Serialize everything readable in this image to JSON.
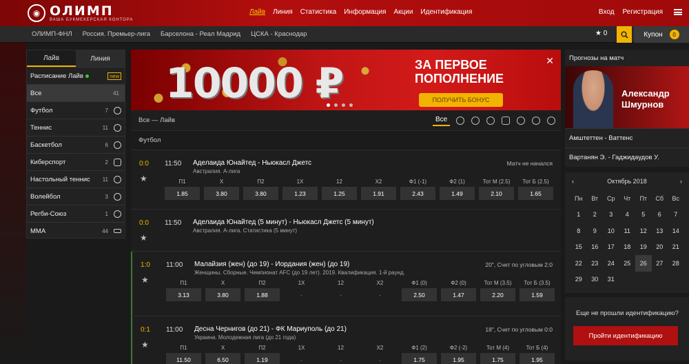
{
  "brand": {
    "name": "ОЛИМП",
    "tagline": "ВАША БУКМЕКЕРСКАЯ КОНТОРА"
  },
  "nav": [
    "Лайв",
    "Линия",
    "Статистика",
    "Информация",
    "Акции",
    "Идентификация"
  ],
  "auth": {
    "login": "Вход",
    "register": "Регистрация"
  },
  "quicklinks": [
    "ОЛИМП-ФНЛ",
    "Россия. Премьер-лига",
    "Барселона - Реал Мадрид",
    "ЦСКА - Краснодар"
  ],
  "favorites": "★ 0",
  "coupon": {
    "label": "Купон",
    "count": "0"
  },
  "left": {
    "tabs": [
      "Лайв",
      "Линия"
    ],
    "schedule": "Расписание Лайв",
    "new": "new",
    "items": [
      {
        "label": "Все",
        "count": "41"
      },
      {
        "label": "Футбол",
        "count": "7"
      },
      {
        "label": "Теннис",
        "count": "11"
      },
      {
        "label": "Баскетбол",
        "count": "6"
      },
      {
        "label": "Киберспорт",
        "count": "2"
      },
      {
        "label": "Настольный теннис",
        "count": "11"
      },
      {
        "label": "Волейбол",
        "count": "3"
      },
      {
        "label": "Регби-Союз",
        "count": "1"
      },
      {
        "label": "MMA",
        "count": "44"
      }
    ]
  },
  "banner": {
    "amount": "10000 ₽",
    "headline": "ЗА ПЕРВОЕ ПОПОЛНЕНИЕ",
    "button": "ПОЛУЧИТЬ БОНУС",
    "close": "✕"
  },
  "center": {
    "crumb": "Все — Лайв",
    "filter_all": "Все",
    "sport": "Футбол"
  },
  "matches": [
    {
      "score": "0:0",
      "time": "11:50",
      "title": "Аделаида Юнайтед - Ньюкасл Джетс",
      "league": "Австралия. А-лига",
      "status": "Матч не начался",
      "odds": [
        [
          "П1",
          "1.85"
        ],
        [
          "Х",
          "3.80"
        ],
        [
          "П2",
          "3.80"
        ],
        [
          "1Х",
          "1.23"
        ],
        [
          "12",
          "1.25"
        ],
        [
          "Х2",
          "1.91"
        ],
        [
          "Ф1 (-1)",
          "2.43"
        ],
        [
          "Ф2 (1)",
          "1.49"
        ],
        [
          "Тот М (2.5)",
          "2.10"
        ],
        [
          "Тот Б (2.5)",
          "1.65"
        ]
      ]
    },
    {
      "score": "0:0",
      "time": "11:50",
      "title": "Аделаида Юнайтед (5 минут) - Ньюкасл Джетс (5 минут)",
      "league": "Австралия. А-лига. Статистика (5 минут)",
      "status": "",
      "odds": []
    },
    {
      "score": "1:0",
      "time": "11:00",
      "title": "Малайзия (жен) (до 19) - Иордания (жен) (до 19)",
      "league": "Женщины. Сборные. Чемпионат AFC (до 19 лет). 2019. Квалификация. 1-й раунд.",
      "status": "20\", Счет по угловым 2:0",
      "odds": [
        [
          "П1",
          "3.13"
        ],
        [
          "Х",
          "3.80"
        ],
        [
          "П2",
          "1.88"
        ],
        [
          "1Х",
          "-"
        ],
        [
          "12",
          "-"
        ],
        [
          "Х2",
          "-"
        ],
        [
          "Ф1 (0)",
          "2.50"
        ],
        [
          "Ф2 (0)",
          "1.47"
        ],
        [
          "Тот М (3.5)",
          "2.20"
        ],
        [
          "Тот Б (3.5)",
          "1.59"
        ]
      ]
    },
    {
      "score": "0:1",
      "time": "11:00",
      "title": "Десна Чернигов (до 21) - ФК Мариуполь (до 21)",
      "league": "Украина. Молодежная лига (до 21 года)",
      "status": "18\", Счет по угловым 0:0",
      "odds": [
        [
          "П1",
          "11.50"
        ],
        [
          "Х",
          "6.50"
        ],
        [
          "П2",
          "1.19"
        ],
        [
          "1Х",
          "-"
        ],
        [
          "12",
          "-"
        ],
        [
          "Х2",
          "-"
        ],
        [
          "Ф1 (2)",
          "1.75"
        ],
        [
          "Ф2 (-2)",
          "1.95"
        ],
        [
          "Тот М (4)",
          "1.75"
        ],
        [
          "Тот Б (4)",
          "1.95"
        ]
      ]
    }
  ],
  "right": {
    "forecast_title": "Прогнозы на матч",
    "expert": "Александр Шмурнов",
    "forecasts": [
      "Амштеттен - Ваттенс",
      "Вартанян Э. - Гаджидаудов У."
    ],
    "month": "Октябрь 2018",
    "weekdays": [
      "Пн",
      "Вт",
      "Ср",
      "Чт",
      "Пт",
      "Сб",
      "Вс"
    ],
    "days": [
      "1",
      "2",
      "3",
      "4",
      "5",
      "6",
      "7",
      "8",
      "9",
      "10",
      "11",
      "12",
      "13",
      "14",
      "15",
      "16",
      "17",
      "18",
      "19",
      "20",
      "21",
      "22",
      "23",
      "24",
      "25",
      "26",
      "27",
      "28",
      "29",
      "30",
      "31"
    ],
    "today": "26",
    "ident_q": "Еще не прошли идентификацию?",
    "ident_btn": "Пройти идентификацию"
  }
}
